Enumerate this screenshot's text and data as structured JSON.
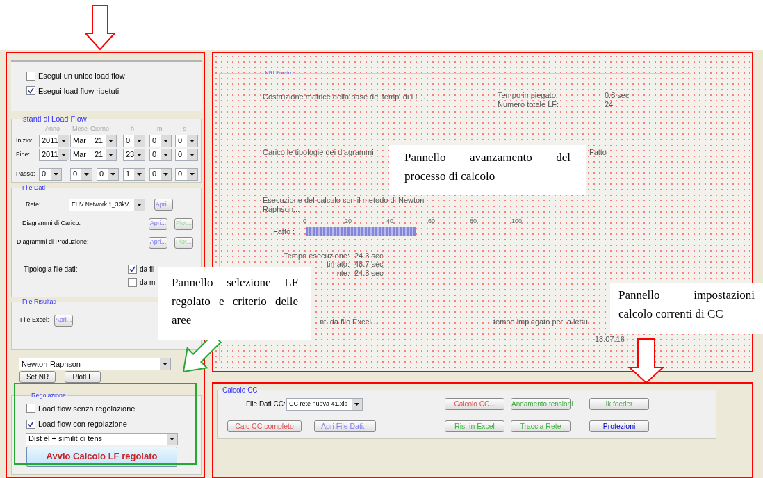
{
  "left_panel": {
    "run_mode": [
      {
        "label": "Esegui un unico load flow",
        "checked": false
      },
      {
        "label": "Esegui load flow ripetuti",
        "checked": true
      }
    ],
    "instants": {
      "title": "Istanti di Load Flow",
      "headers": [
        "Anno",
        "Mese",
        "Giorno",
        "h",
        "m",
        "s"
      ],
      "rows": [
        {
          "label": "Inizio:",
          "fields": [
            [
              "2011"
            ],
            [
              "Mar",
              "21"
            ],
            [
              "0"
            ],
            [
              "0"
            ],
            [
              "0"
            ]
          ]
        },
        {
          "label": "Fine:",
          "fields": [
            [
              "2011"
            ],
            [
              "Mar",
              "21"
            ],
            [
              "23"
            ],
            [
              "0"
            ],
            [
              "0"
            ]
          ]
        },
        {
          "label": "Passo:",
          "fields": [
            [
              "0"
            ],
            [
              "0"
            ],
            [
              "0"
            ],
            [
              "1"
            ],
            [
              "0"
            ],
            [
              "0"
            ]
          ]
        }
      ]
    },
    "data_files": {
      "title": "File Dati",
      "network_label": "Rete:",
      "network_value": "EHV Network 1_33kV...",
      "network_button": "Apri...",
      "diagrams": [
        {
          "label": "Diagrammi di Carico:",
          "open_button": "Apri...",
          "plot_button": "Plot..."
        },
        {
          "label": "Diagrammi di Produzione:",
          "open_button": "Apri...",
          "plot_button": "Plot..."
        }
      ],
      "type_label": "Tipologia file dati:",
      "type_options": [
        {
          "label": "da fil",
          "checked": true
        },
        {
          "label": "da m",
          "checked": false
        }
      ]
    },
    "results": {
      "title": "File Risultati",
      "excel_label": "File Excel:",
      "excel_button": "Apri..."
    },
    "method": {
      "value": "Newton-Raphson",
      "buttons": [
        "Set NR",
        "PlotLF"
      ]
    },
    "regulation": {
      "title": "Regolazione",
      "options": [
        {
          "label": "Load flow senza regolazione",
          "checked": false
        },
        {
          "label": "Load flow con regolazione",
          "checked": true
        }
      ],
      "criterion": "Dist el + similit di tens",
      "run_button": "Avvio Calcolo LF regolato"
    }
  },
  "progress_panel": {
    "title": "NRLFmain",
    "matrix": {
      "text": "Costruzione matrice della base dei tempi di LF...",
      "stats": [
        {
          "label": "Tempo impiegato:",
          "value": "0.8 sec"
        },
        {
          "label": "Numero totale LF:",
          "value": "24"
        }
      ]
    },
    "diagrams": {
      "text": "Carico le tipologie dei diagrammi",
      "status": "Fatto"
    },
    "calculation": {
      "text": "Esecuzione del calcolo con il metodo di Newton-Raphson...",
      "ticks": [
        "0",
        "20",
        "40",
        "60",
        "80",
        "100"
      ],
      "progress_label": "Fatto :",
      "times": [
        {
          "label": "Tempo esecuzione:",
          "value": "24.3 sec"
        },
        {
          "label": "timato:",
          "value": "48.7 sec"
        },
        {
          "label": "nte:",
          "value": "24.3 sec"
        }
      ]
    },
    "excel": {
      "text": "nti da file Excel...",
      "time_label": "tempo impiegato per la lettu",
      "time_value": "13.07.16"
    }
  },
  "cc_panel": {
    "title": "Calcolo CC",
    "file_label": "File Dati CC:",
    "file_value": "CC rete nuova 41.xls",
    "row_1_buttons": [
      {
        "label": "Calcolo CC...",
        "color": "#e05050"
      },
      {
        "label": "Andamento tensioni",
        "color": "#3fb03f"
      },
      {
        "label": "Ik feeder",
        "color": "#5aa85a"
      }
    ],
    "row_2_buttons": [
      {
        "label": "Calc CC completo",
        "color": "#e05050"
      },
      {
        "label": "Apri File Dati...",
        "color": "#8080ee"
      },
      {
        "label": "Ris. in Excel",
        "color": "#3fb03f"
      },
      {
        "label": "Traccia Rete",
        "color": "#3fb03f"
      },
      {
        "label": "Protezioni",
        "color": "#0000cc"
      }
    ]
  },
  "callouts": [
    {
      "text": "Pannello avanzamento del processo di calcolo"
    },
    {
      "text": "Pannello selezione LF regolato e criterio delle aree"
    },
    {
      "text": "Pannello impostazioni calcolo correnti di CC"
    }
  ]
}
